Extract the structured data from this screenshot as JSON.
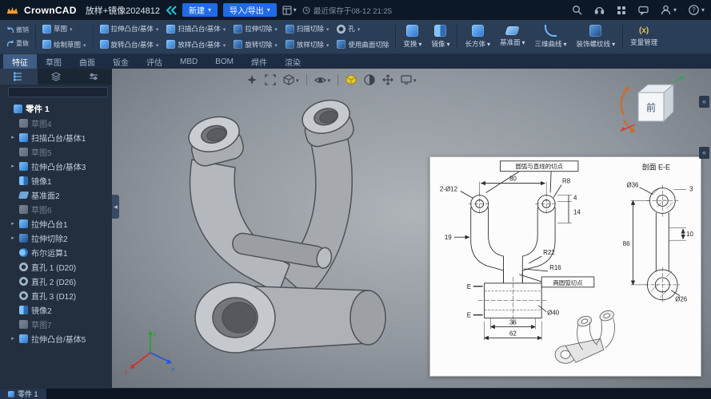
{
  "colors": {
    "accent_blue": "#1f6be8",
    "titlebar_bg": "#0d1826",
    "ribbon_bg": "#2b3e58",
    "viewport_gray": "#91979e",
    "appearance_yellow": "#e6c52f"
  },
  "titlebar": {
    "app_name": "CrownCAD",
    "doc_title": "放样+镜像2024812",
    "new_button": "新建",
    "import_export_button": "导入/导出",
    "save_status": "最近保存于08-12 21:25"
  },
  "ribbon": {
    "undo": "撤销",
    "redo": "重做",
    "sketch": "草图",
    "draw_sketch": "绘制草图",
    "extrude_boss": "拉伸凸台/基体",
    "revolve_boss": "旋转凸台/基体",
    "sweep_boss": "扫描凸台/基体",
    "loft_boss": "放样凸台/基体",
    "extrude_cut": "拉伸切除",
    "revolve_cut": "旋转切除",
    "sweep_cut": "扫描切除",
    "loft_cut": "放样切除",
    "hole": "孔",
    "surface_cut": "使用曲面切除",
    "transform": "变换",
    "mirror": "镜像",
    "box": "长方体",
    "datum_plane": "基准面",
    "curve_3d": "三维曲线",
    "cosmetic_thread": "装饰螺纹线",
    "variable_manager": "变量管理",
    "variable_icon": "(x)"
  },
  "tabs": {
    "items": [
      "特征",
      "草图",
      "曲面",
      "钣金",
      "评估",
      "MBD",
      "BOM",
      "焊件",
      "渲染"
    ],
    "active": "特征"
  },
  "tree": {
    "root": "零件 1",
    "items": [
      {
        "label": "草图4",
        "icon": "sketch-icon"
      },
      {
        "label": "扫描凸台/基体1",
        "icon": "sweep-boss-icon"
      },
      {
        "label": "草图5",
        "icon": "sketch-icon"
      },
      {
        "label": "拉伸凸台/基体3",
        "icon": "extrude-boss-icon"
      },
      {
        "label": "镜像1",
        "icon": "mirror-icon"
      },
      {
        "label": "基准面2",
        "icon": "datum-plane-icon"
      },
      {
        "label": "草图6",
        "icon": "sketch-icon"
      },
      {
        "label": "拉伸凸台1",
        "icon": "extrude-boss-icon"
      },
      {
        "label": "拉伸切除2",
        "icon": "extrude-cut-icon"
      },
      {
        "label": "布尔运算1",
        "icon": "boolean-icon"
      },
      {
        "label": "直孔 1 (D20)",
        "icon": "hole-icon"
      },
      {
        "label": "直孔 2 (D26)",
        "icon": "hole-icon"
      },
      {
        "label": "直孔 3 (D12)",
        "icon": "hole-icon"
      },
      {
        "label": "镜像2",
        "icon": "mirror-icon"
      },
      {
        "label": "草图7",
        "icon": "sketch-icon"
      },
      {
        "label": "拉伸凸台/基体5",
        "icon": "extrude-boss-icon"
      }
    ]
  },
  "viewcube": {
    "front_label": "前"
  },
  "axes": {
    "x": "x",
    "y": "y",
    "z": "z"
  },
  "statusbar": {
    "part_tab": "零件 1"
  },
  "drawing": {
    "callout_tangent_line": "圆弧与直线的切点",
    "callout_tangent_arcs": "两圆弧切点",
    "section_title": "剖面 E-E",
    "dim_80": "80",
    "dim_r8": "R8",
    "dim_2xd12": "2-Ø12",
    "dim_4": "4",
    "dim_14": "14",
    "dim_19": "19",
    "dim_r22": "R22",
    "dim_r16": "R16",
    "dim_36": "36",
    "dim_62": "62",
    "label_e": "E",
    "dim_dia40": "Ø40",
    "dim_dia36": "Ø36",
    "dim_3": "3",
    "dim_86": "86",
    "dim_10": "10",
    "dim_dia26": "Ø26"
  }
}
